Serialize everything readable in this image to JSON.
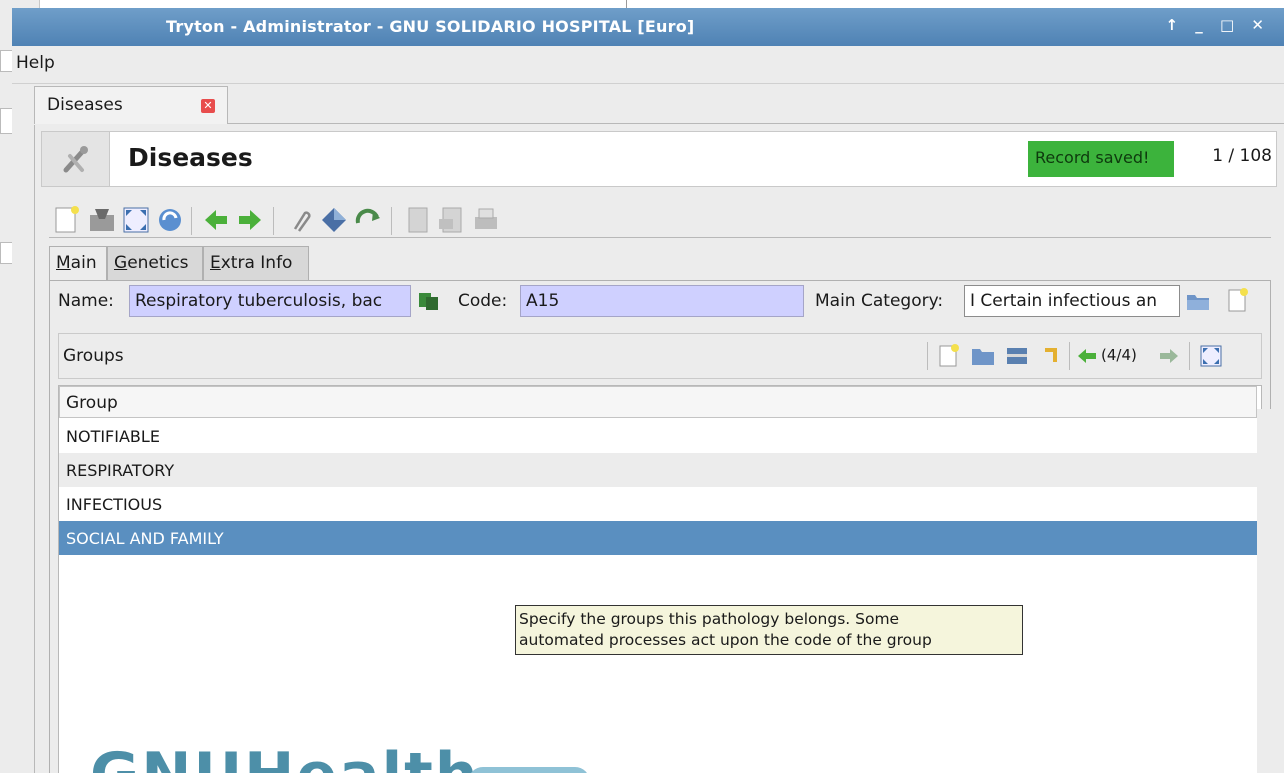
{
  "window": {
    "title": "Tryton - Administrator - GNU SOLIDARIO HOSPITAL [Euro]",
    "controls": "↑ _ □ ✕"
  },
  "menu": {
    "help": "Help"
  },
  "tab": {
    "label": "Diseases"
  },
  "header": {
    "title": "Diseases",
    "status": "Record saved!",
    "record_count": "1 / 108"
  },
  "form_tabs": [
    {
      "label": "Main",
      "accel": "M",
      "rest": "ain"
    },
    {
      "label": "Genetics",
      "accel": "G",
      "rest": "enetics"
    },
    {
      "label": "Extra Info",
      "accel": "E",
      "rest": "xtra Info"
    }
  ],
  "fields": {
    "name_label": "Name:",
    "name_value": "Respiratory tuberculosis, bac",
    "code_label": "Code:",
    "code_value": "A15",
    "category_label": "Main Category:",
    "category_value": "I Certain infectious an"
  },
  "groups": {
    "label": "Groups",
    "pager": "(4/4)",
    "column": "Group",
    "rows": [
      "NOTIFIABLE",
      "RESPIRATORY",
      "INFECTIOUS",
      "SOCIAL AND FAMILY"
    ]
  },
  "tooltip": {
    "line1": "Specify the groups this pathology belongs. Some",
    "line2": "automated processes act upon the code of the group"
  },
  "logo": {
    "text": "GNUHealth"
  },
  "colors": {
    "titlebar": "#4f82b4",
    "selected_row": "#5a8fc0",
    "status_green": "#3cb33c",
    "required_field": "#cfd0ff"
  }
}
